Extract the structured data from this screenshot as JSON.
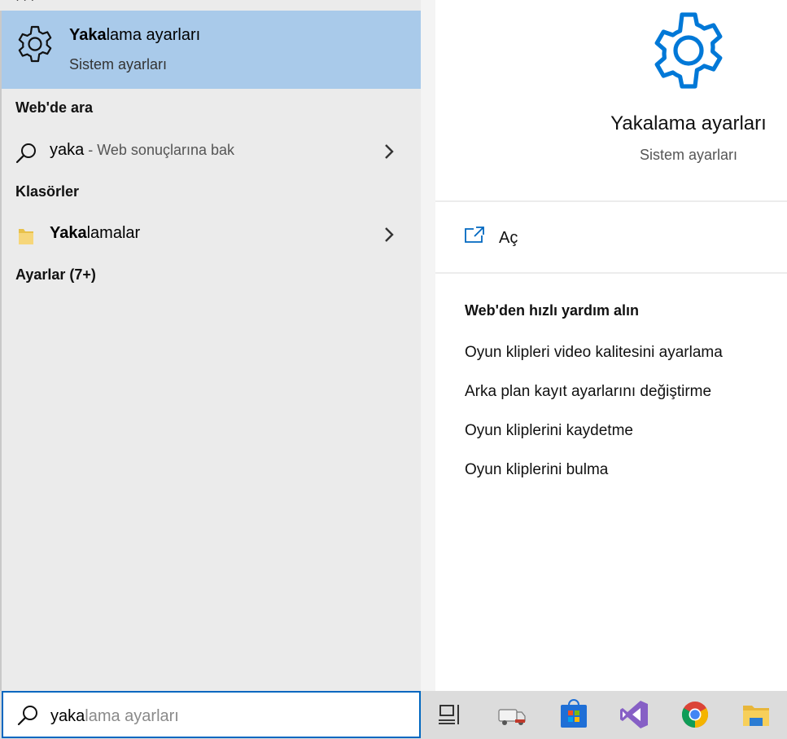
{
  "search_results": {
    "best_match": {
      "title_bold": "Yaka",
      "title_rest": "lama ayarları",
      "subtitle": "Sistem ayarları",
      "icon": "gear-icon"
    },
    "web_section": {
      "heading": "Web'de ara",
      "query": "yaka",
      "hint": " - Web sonuçlarına bak",
      "icon": "search-icon"
    },
    "folders_section": {
      "heading": "Klasörler",
      "item_bold": "Yaka",
      "item_rest": "lamalar",
      "icon": "folder-icon"
    },
    "settings_section": {
      "heading": "Ayarlar (7+)"
    }
  },
  "preview": {
    "title": "Yakalama ayarları",
    "subtitle": "Sistem ayarları",
    "icon": "gear-icon",
    "open_label": "Aç",
    "help_heading": "Web'den hızlı yardım alın",
    "help_links": [
      "Oyun klipleri video kalitesini ayarlama",
      "Arka plan kayıt ayarlarını değiştirme",
      "Oyun kliplerini kaydetme",
      "Oyun kliplerini bulma"
    ]
  },
  "search_box": {
    "typed": "yaka",
    "suggestion": "lama ayarları"
  },
  "taskbar": {
    "icons": [
      "task-view-icon",
      "truck-app-icon",
      "microsoft-store-icon",
      "visual-studio-icon",
      "chrome-icon",
      "file-explorer-icon"
    ]
  },
  "colors": {
    "accent": "#0067c0",
    "selection": "#a9caea",
    "settings_blue": "#0078d7"
  }
}
